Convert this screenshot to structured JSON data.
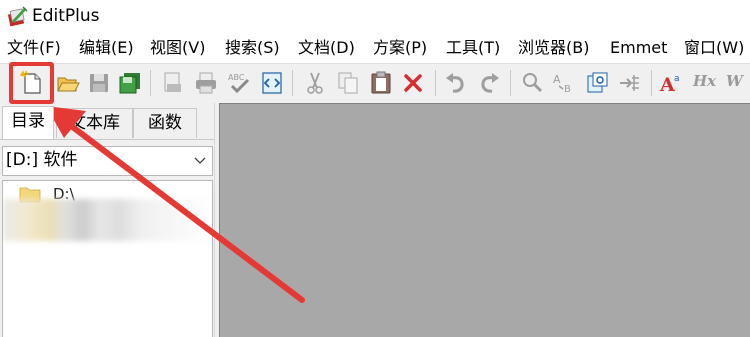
{
  "window": {
    "title": "EditPlus",
    "app_icon": "editplus-app-icon"
  },
  "menubar": {
    "items": [
      {
        "label": "文件(F)"
      },
      {
        "label": "编辑(E)"
      },
      {
        "label": "视图(V)"
      },
      {
        "label": "搜索(S)"
      },
      {
        "label": "文档(D)"
      },
      {
        "label": "方案(P)"
      },
      {
        "label": "工具(T)"
      },
      {
        "label": "浏览器(B)"
      },
      {
        "label": "Emmet"
      },
      {
        "label": "窗口(W)"
      }
    ]
  },
  "toolbar": {
    "buttons": [
      {
        "icon": "new-file-icon"
      },
      {
        "icon": "open-folder-icon"
      },
      {
        "icon": "save-icon"
      },
      {
        "icon": "save-all-icon"
      },
      {
        "icon": "print-preview-icon"
      },
      {
        "icon": "print-icon"
      },
      {
        "icon": "spell-check-icon"
      },
      {
        "icon": "browser-view-icon"
      },
      {
        "icon": "cut-icon"
      },
      {
        "icon": "copy-icon"
      },
      {
        "icon": "paste-icon"
      },
      {
        "icon": "delete-icon"
      },
      {
        "icon": "undo-icon"
      },
      {
        "icon": "redo-icon"
      },
      {
        "icon": "find-icon"
      },
      {
        "icon": "replace-icon"
      },
      {
        "icon": "find-in-files-icon"
      },
      {
        "icon": "goto-line-icon"
      },
      {
        "icon": "font-icon"
      },
      {
        "icon": "heading-icon"
      }
    ],
    "font_glyph": "A",
    "heading_label": "Hx",
    "wrap_label": "W"
  },
  "left_panel": {
    "tabs": [
      {
        "label": "目录",
        "active": true
      },
      {
        "label": "文本库",
        "active": false
      },
      {
        "label": "函数",
        "active": false
      }
    ],
    "drive_select": {
      "value": "[D:] 软件"
    },
    "tree": {
      "root_label": "D:\\"
    }
  },
  "annotation": {
    "highlight_color": "#e53935",
    "target": "new-file-button"
  },
  "colors": {
    "editor_background": "#a8a8a8",
    "panel_background": "#f0f0f0",
    "accent_red": "#e53935"
  }
}
